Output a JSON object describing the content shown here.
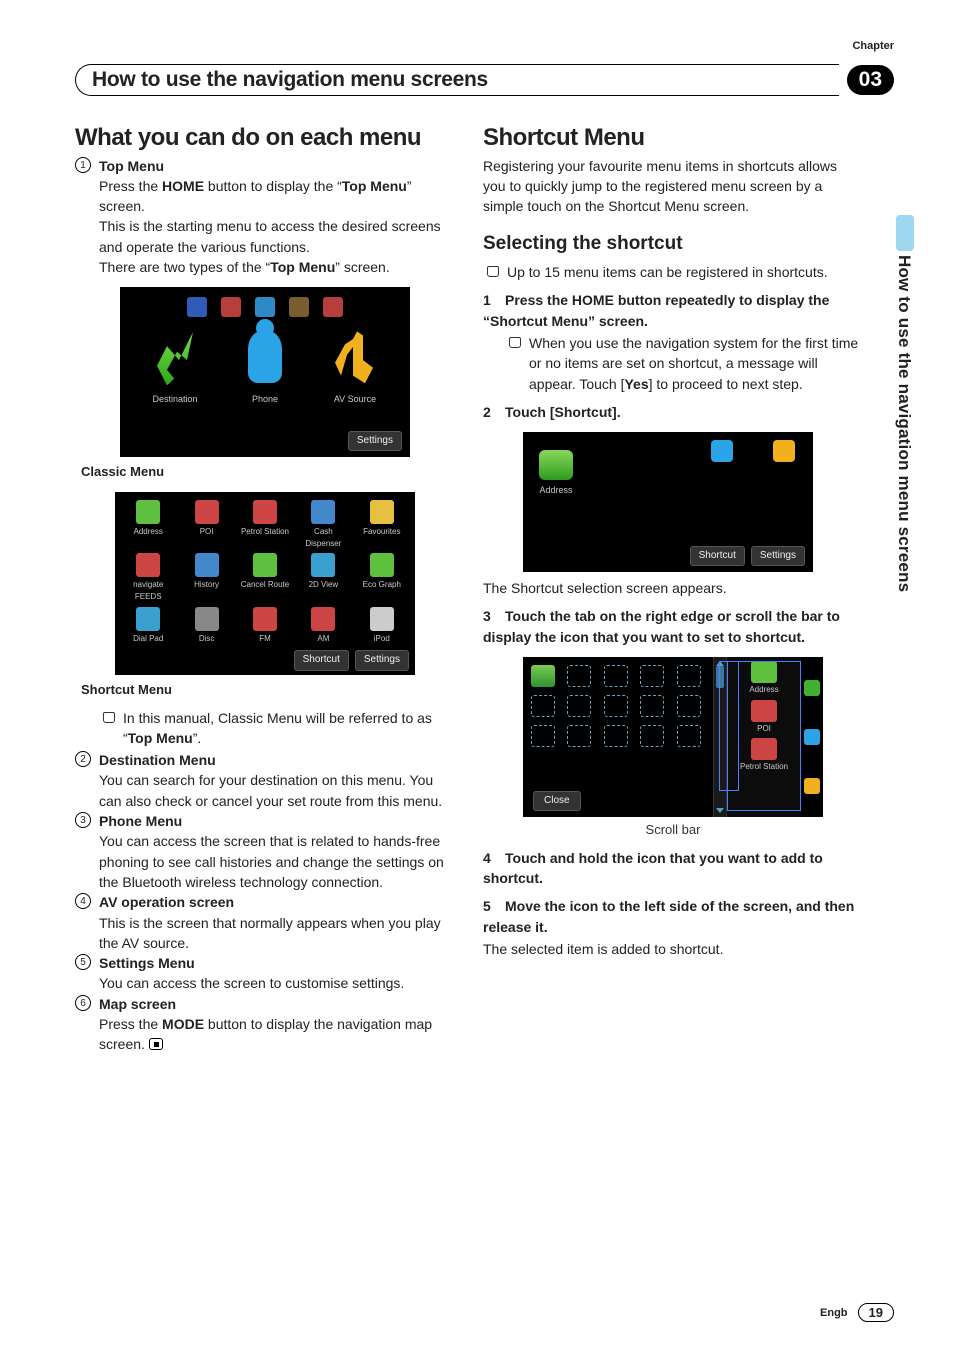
{
  "chapter_label": "Chapter",
  "chapter_num": "03",
  "header_title": "How to use the navigation menu screens",
  "side_tab": "How to use the navigation menu screens",
  "left": {
    "h1": "What you can do on each menu",
    "items": [
      {
        "num": "1",
        "label": "Top Menu",
        "body": [
          "Press the ",
          "HOME",
          " button to display the “",
          "Top Menu",
          "” screen.",
          "This is the starting menu to access the desired screens and operate the various functions.",
          "There are two types of the “",
          "Top Menu",
          "” screen."
        ]
      },
      {
        "num": "2",
        "label": "Destination Menu",
        "body_plain": "You can search for your destination on this menu. You can also check or cancel your set route from this menu."
      },
      {
        "num": "3",
        "label": "Phone Menu",
        "body_plain": "You can access the screen that is related to hands-free phoning to see call histories and change the settings on the Bluetooth wireless technology connection."
      },
      {
        "num": "4",
        "label": "AV operation screen",
        "body_plain": "This is the screen that normally appears when you play the AV source."
      },
      {
        "num": "5",
        "label": "Settings Menu",
        "body_plain": "You can access the screen to customise settings."
      },
      {
        "num": "6",
        "label": "Map screen",
        "body_plain_parts": [
          "Press the ",
          "MODE",
          " button to display the navigation map screen."
        ]
      }
    ],
    "caption_classic": "Classic Menu",
    "caption_shortcut": "Shortcut Menu",
    "bullet_classic": [
      "In this manual, Classic Menu will be referred to as “",
      "Top Menu",
      "”."
    ],
    "mock1": {
      "labels": [
        "Destination",
        "Phone",
        "AV Source"
      ],
      "settings": "Settings"
    },
    "mock2": {
      "row1": [
        "Address",
        "POI",
        "Petrol Station",
        "Cash Dispenser",
        "Favourites"
      ],
      "row2": [
        "navigate FEEDS",
        "History",
        "Cancel Route",
        "2D View",
        "Eco Graph"
      ],
      "row3": [
        "Dial Pad",
        "Disc",
        "FM",
        "AM",
        "iPod"
      ],
      "buttons": [
        "Shortcut",
        "Settings"
      ]
    }
  },
  "right": {
    "h1": "Shortcut Menu",
    "intro": "Registering your favourite menu items in shortcuts allows you to quickly jump to the registered menu screen by a simple touch on the Shortcut Menu screen.",
    "h2": "Selecting the shortcut",
    "bullet1": "Up to 15 menu items can be registered in shortcuts.",
    "step1": "Press the HOME button repeatedly to display the “Shortcut Menu” screen.",
    "step1_sub_parts": [
      "When you use the navigation system for the first time or no items are set on shortcut, a message will appear. Touch [",
      "Yes",
      "] to proceed to next step."
    ],
    "step2": "Touch [Shortcut].",
    "mock3": {
      "address": "Address",
      "buttons": [
        "Shortcut",
        "Settings"
      ]
    },
    "after_mock3": "The Shortcut selection screen appears.",
    "step3": "Touch the tab on the right edge or scroll the bar to display the icon that you want to set to shortcut.",
    "mock4": {
      "right_items": [
        "Address",
        "POI",
        "Petrol Station"
      ],
      "close": "Close"
    },
    "scrollbar_caption": "Scroll bar",
    "step4": "Touch and hold the icon that you want to add to shortcut.",
    "step5": "Move the icon to the left side of the screen, and then release it.",
    "after_step5": "The selected item is added to shortcut."
  },
  "footer": {
    "lang": "Engb",
    "page": "19"
  }
}
